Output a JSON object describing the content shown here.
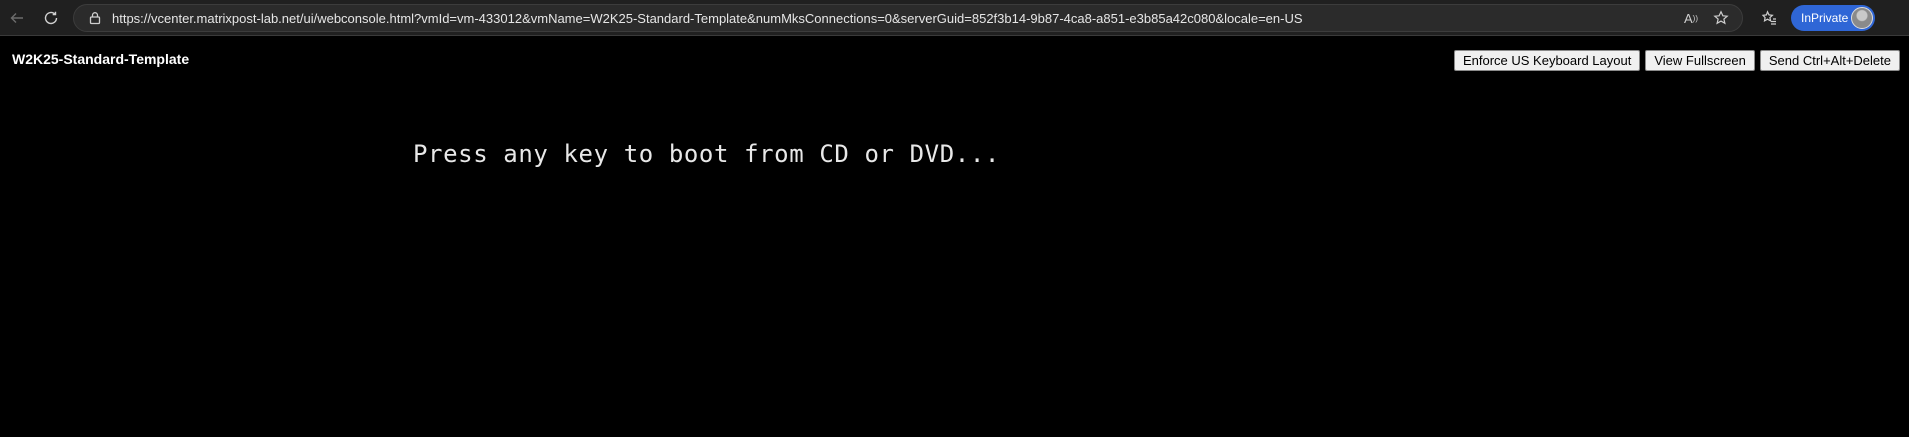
{
  "browser": {
    "url": "https://vcenter.matrixpost-lab.net/ui/webconsole.html?vmId=vm-433012&vmName=W2K25-Standard-Template&numMksConnections=0&serverGuid=852f3b14-9b87-4ca8-a851-e3b85a42c080&locale=en-US",
    "read_aloud_glyph": "A",
    "inprivate_label": "InPrivate",
    "icons": [
      "back-icon",
      "reload-icon",
      "lock-icon",
      "read-aloud-icon",
      "star-icon",
      "favorites-icon"
    ]
  },
  "console": {
    "title": "W2K25-Standard-Template",
    "buttons": {
      "keyboard_layout": "Enforce US Keyboard Layout",
      "fullscreen": "View Fullscreen",
      "ctrl_alt_del": "Send Ctrl+Alt+Delete"
    },
    "screen_text": "Press any key to boot from CD or DVD..."
  },
  "colors": {
    "background": "#000000",
    "chrome": "#202020",
    "inprivate_badge": "#2f66d6"
  }
}
